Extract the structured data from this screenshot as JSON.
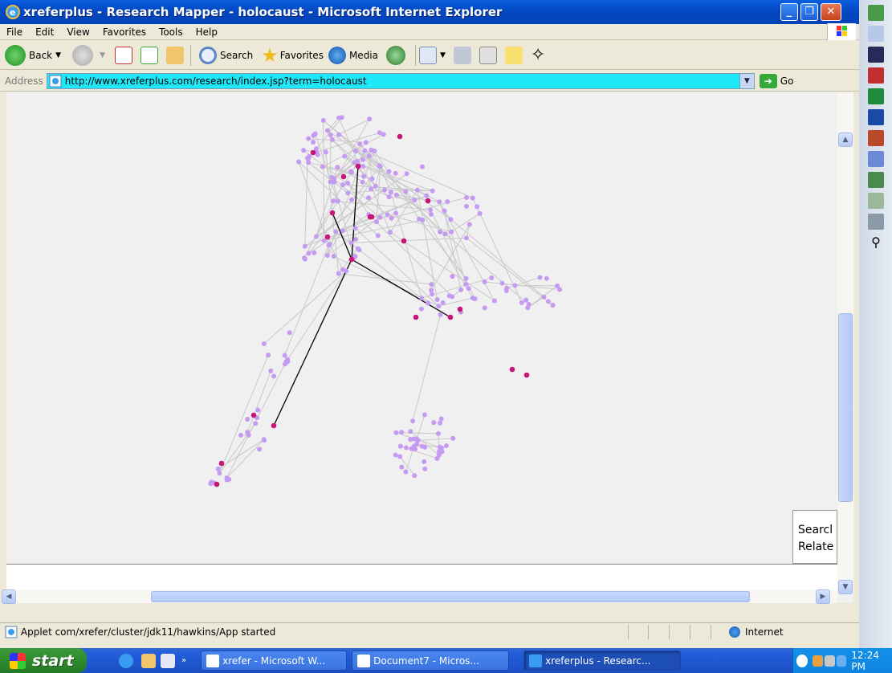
{
  "window": {
    "title": "xreferplus - Research Mapper - holocaust - Microsoft Internet Explorer"
  },
  "menu": {
    "items": [
      "File",
      "Edit",
      "View",
      "Favorites",
      "Tools",
      "Help"
    ]
  },
  "toolbar": {
    "back_label": "Back",
    "search_label": "Search",
    "favorites_label": "Favorites",
    "media_label": "Media"
  },
  "address": {
    "label": "Address",
    "url": "http://www.xreferplus.com/research/index.jsp?term=holocaust",
    "go_label": "Go"
  },
  "applet": {
    "search_box_lines": [
      "Searcl",
      "Relate"
    ],
    "colors": {
      "node": "#c59af2",
      "highlight": "#c8157a",
      "edge": "#c8c8c8",
      "path": "#000000"
    }
  },
  "status": {
    "text": "Applet com/xrefer/cluster/jdk11/hawkins/App started",
    "zone": "Internet"
  },
  "taskbar": {
    "start_label": "start",
    "tasks": [
      "xrefer - Microsoft W...",
      "Document7 - Micros...",
      "xreferplus - Researc..."
    ],
    "clock": "12:24 PM"
  }
}
